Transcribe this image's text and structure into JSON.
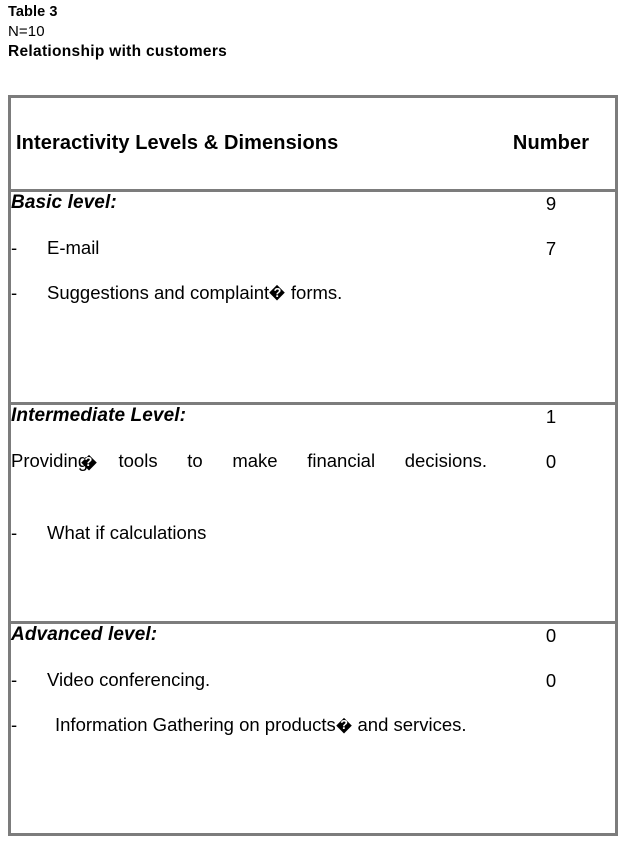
{
  "caption": {
    "table_label": "Table 3",
    "sample_size": "N=10",
    "title": "Relationship with customers"
  },
  "table": {
    "columns": [
      {
        "header": "Interactivity Levels & Dimensions"
      },
      {
        "header": "Number"
      }
    ],
    "rows": [
      {
        "level": "Basic level:",
        "level_number": "9",
        "items": [
          {
            "dash": "-",
            "text_before": "E-mail",
            "has_replacement": false,
            "text_after": "",
            "number": "7",
            "justify": false
          },
          {
            "dash": "-",
            "text_before": "Suggestions and complaint",
            "has_replacement": true,
            "text_after": " forms.",
            "number": "",
            "justify": false
          }
        ]
      },
      {
        "level": "Intermediate Level:",
        "level_number": "1",
        "items": [
          {
            "dash": "",
            "text_before": "Providing",
            "has_replacement": true,
            "text_after": " tools to make financial decisions.",
            "number": "0",
            "justify": true
          },
          {
            "dash": "-",
            "text_before": "What if calculations",
            "has_replacement": false,
            "text_after": "",
            "number": "",
            "justify": false
          }
        ]
      },
      {
        "level": "Advanced level:",
        "level_number": "0",
        "items": [
          {
            "dash": "-",
            "text_before": "Video conferencing.",
            "has_replacement": false,
            "text_after": "",
            "number": "0",
            "justify": false
          },
          {
            "dash": "-",
            "text_before": "Information Gathering on products",
            "has_replacement": true,
            "text_after": " and services.",
            "number": "",
            "justify": true
          }
        ]
      }
    ]
  }
}
